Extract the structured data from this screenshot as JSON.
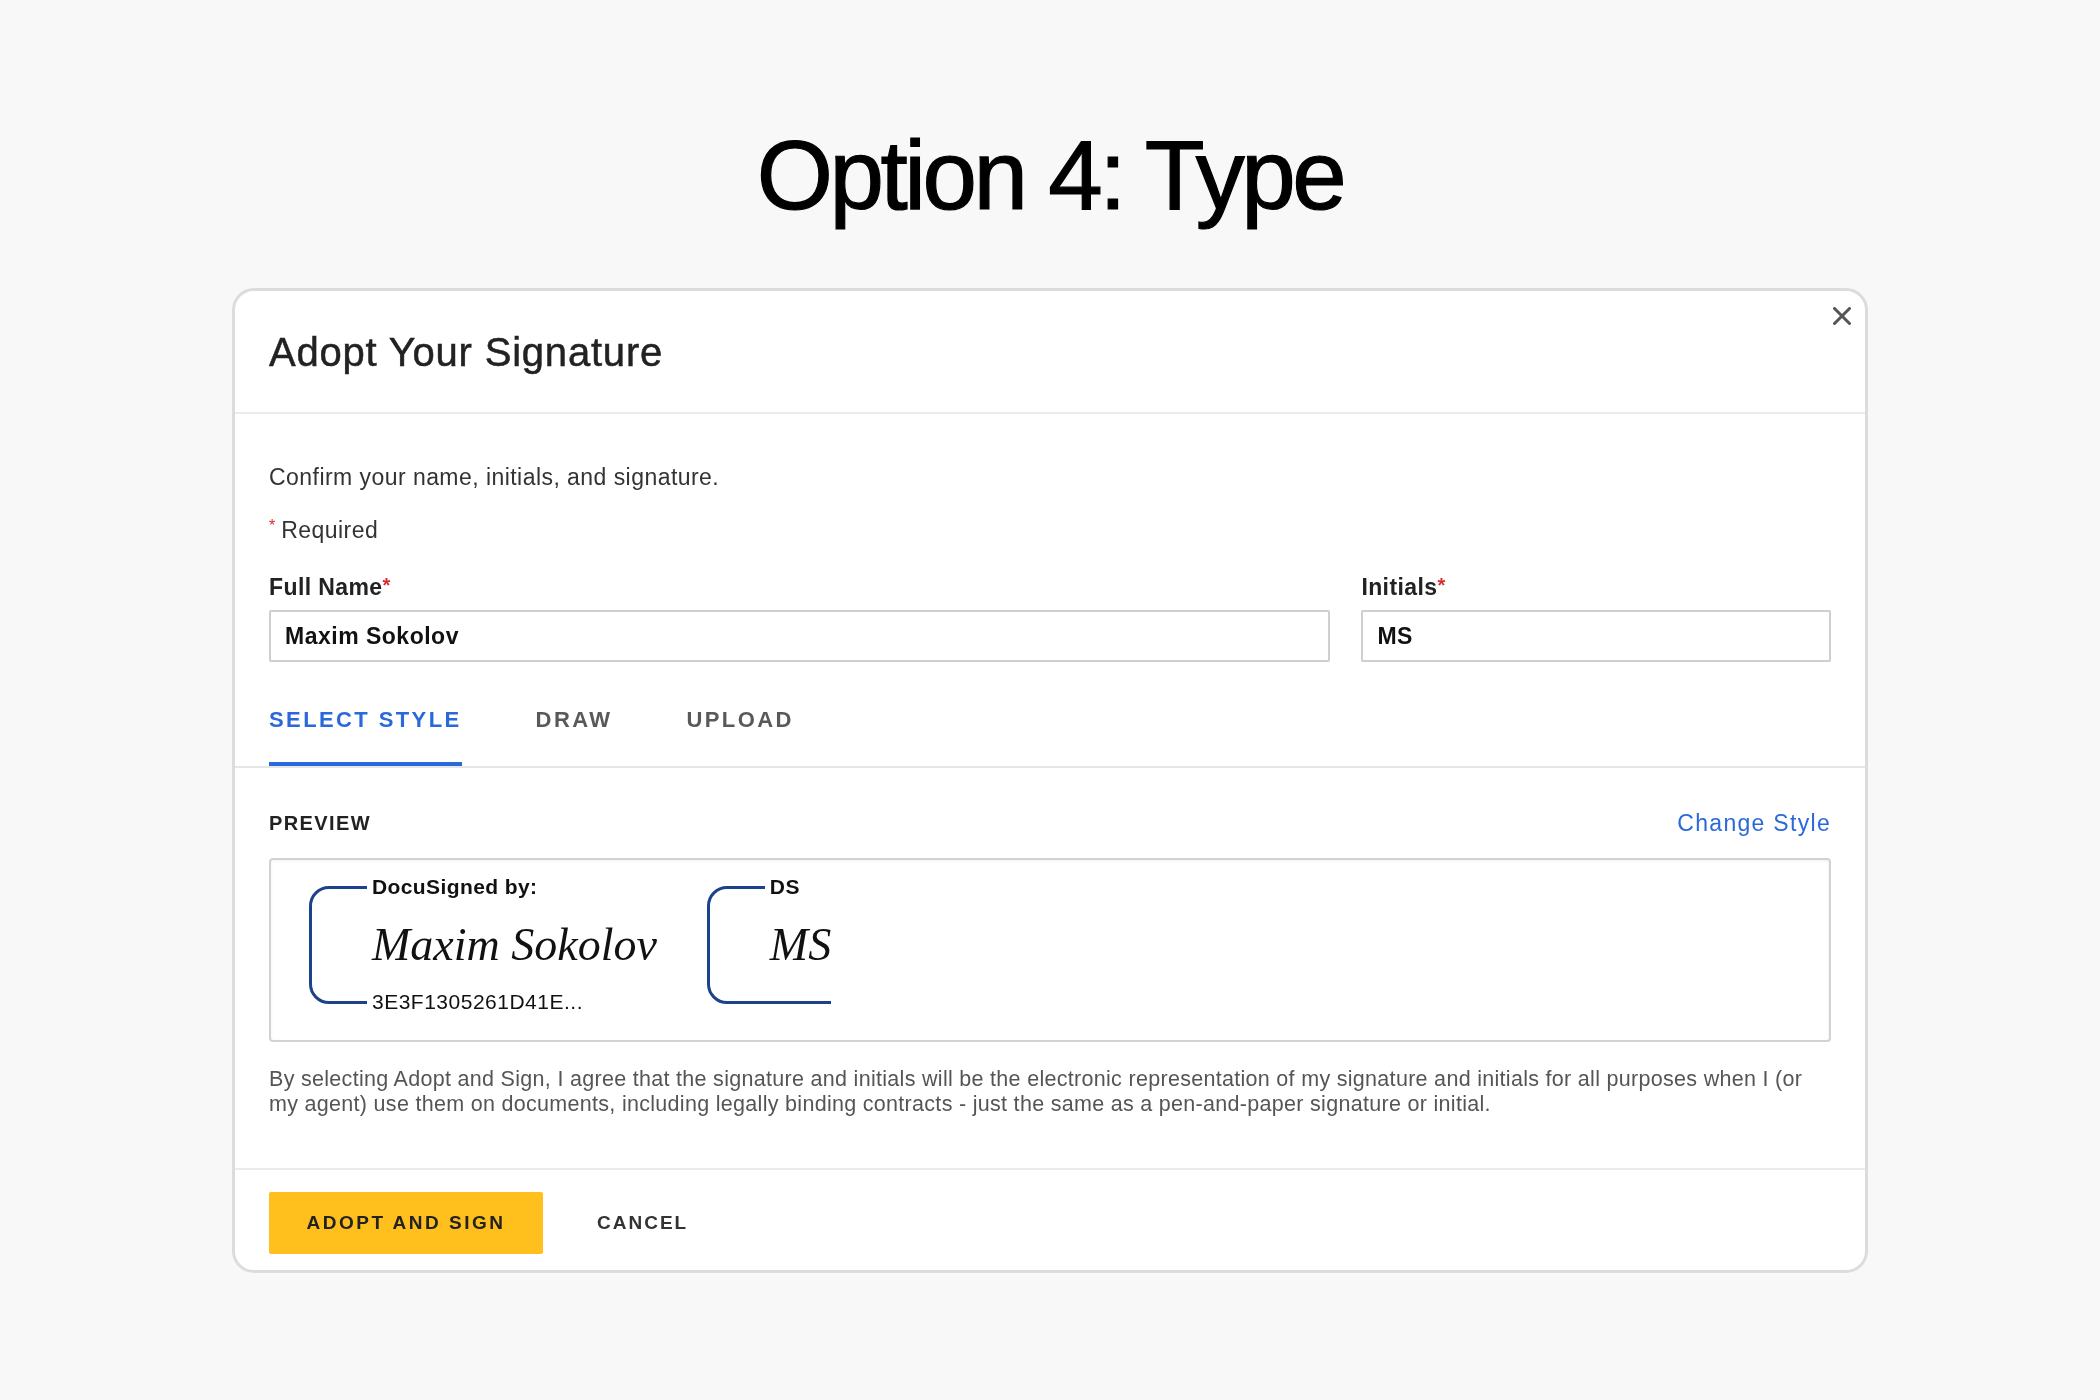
{
  "page_title": "Option 4: Type",
  "dialog": {
    "title": "Adopt Your Signature",
    "intro": "Confirm your name, initials, and signature.",
    "required_note": {
      "mark": "*",
      "text": "Required"
    },
    "fields": [
      {
        "label": "Full Name",
        "required_mark": "*",
        "value": "Maxim Sokolov"
      },
      {
        "label": "Initials",
        "required_mark": "*",
        "value": "MS"
      }
    ],
    "tabs": [
      {
        "label": "SELECT STYLE",
        "selected": true
      },
      {
        "label": "DRAW",
        "selected": false
      },
      {
        "label": "UPLOAD",
        "selected": false
      }
    ],
    "preview": {
      "label": "PREVIEW",
      "link": "Change Style",
      "stamps": [
        {
          "kind": "signature",
          "caption": "DocuSigned by:",
          "text": "Maxim Sokolov",
          "code": "3E3F1305261D41E..."
        },
        {
          "kind": "initials",
          "caption": "DS",
          "text": "MS"
        }
      ]
    },
    "disclaimer": "By selecting Adopt and Sign, I agree that the signature and initials will be the electronic representation of my signature and initials for all purposes when I (or my agent) use them on documents, including legally binding contracts - just the same as a pen-and-paper signature or initial.",
    "buttons": [
      {
        "label": "ADOPT AND SIGN",
        "kind": "primary"
      },
      {
        "label": "CANCEL",
        "kind": "plain"
      }
    ]
  }
}
